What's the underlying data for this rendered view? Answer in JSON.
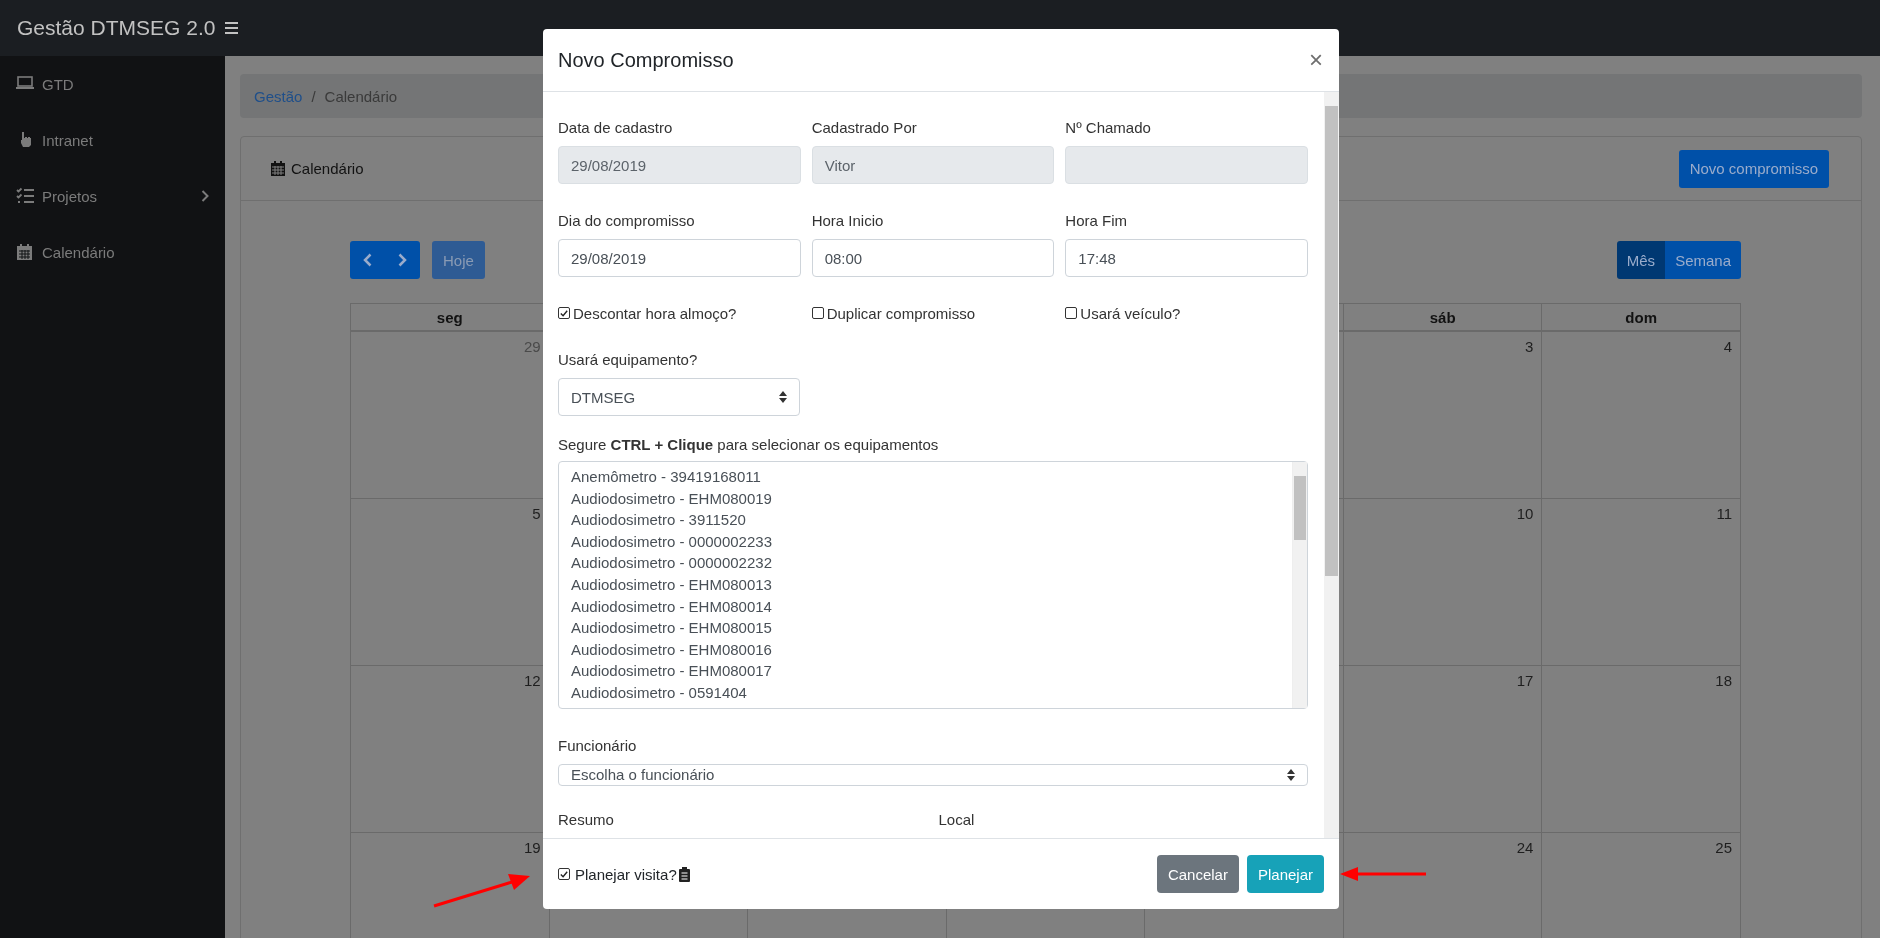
{
  "topbar": {
    "title": "Gestão DTMSEG 2.0"
  },
  "sidebar": {
    "items": [
      {
        "label": "GTD",
        "expandable": false
      },
      {
        "label": "Intranet",
        "expandable": false
      },
      {
        "label": "Projetos",
        "expandable": true
      },
      {
        "label": "Calendário",
        "expandable": false
      }
    ]
  },
  "breadcrumb": [
    {
      "label": "Gestão",
      "link": true
    },
    {
      "label": "/",
      "link": false
    },
    {
      "label": "Calendário",
      "link": false
    }
  ],
  "card": {
    "title": "Calendário",
    "new_button": "Novo compromisso"
  },
  "calendar": {
    "today_button": {
      "label": "Hoje",
      "disabled": true
    },
    "views": [
      {
        "label": "Mês",
        "selected": true
      },
      {
        "label": "Semana",
        "selected": false
      }
    ],
    "columns": [
      {
        "label": "seg",
        "days": [
          {
            "day": "29",
            "other_month": true
          },
          {
            "day": "5",
            "other_month": false
          },
          {
            "day": "12",
            "other_month": false
          },
          {
            "day": "19",
            "other_month": false
          }
        ]
      },
      {
        "label": "sáb",
        "days": [
          {
            "day": "3",
            "other_month": false
          },
          {
            "day": "10",
            "other_month": false
          },
          {
            "day": "17",
            "other_month": false
          },
          {
            "day": "24",
            "other_month": false
          }
        ]
      },
      {
        "label": "dom",
        "days": [
          {
            "day": "4",
            "other_month": false
          },
          {
            "day": "11",
            "other_month": false
          },
          {
            "day": "18",
            "other_month": false
          },
          {
            "day": "25",
            "other_month": false
          }
        ]
      }
    ]
  },
  "modal": {
    "title": "Novo Compromisso",
    "close": "×",
    "fields": [
      {
        "label": "Data de cadastro",
        "value": "29/08/2019",
        "readonly": true
      },
      {
        "label": "Cadastrado Por",
        "value": "Vitor",
        "readonly": true
      },
      {
        "label": "Nº Chamado",
        "readonly": true
      },
      {
        "label": "Dia do compromisso",
        "value": "29/08/2019",
        "readonly": false
      },
      {
        "label": "Hora Inicio",
        "value": "08:00",
        "readonly": false
      },
      {
        "label": "Hora Fim",
        "value": "17:48",
        "readonly": false
      }
    ],
    "checks": [
      {
        "label": "Descontar hora almoço?",
        "checked": true
      },
      {
        "label": "Duplicar compromisso",
        "checked": false
      },
      {
        "label": "Usará veículo?",
        "checked": false
      }
    ],
    "equipment_select": {
      "label": "Usará equipamento?",
      "value": "DTMSEG"
    },
    "hint": "Segure **CTRL + Clique** para selecionar os equipamentos",
    "equipment_list": [
      "Anemômetro - 39419168011",
      "Audiodosimetro - EHM080019",
      "Audiodosimetro - 3911520",
      "Audiodosimetro - 0000002233",
      "Audiodosimetro - 0000002232",
      "Audiodosimetro - EHM080013",
      "Audiodosimetro - EHM080014",
      "Audiodosimetro - EHM080015",
      "Audiodosimetro - EHM080016",
      "Audiodosimetro - EHM080017",
      "Audiodosimetro - 0591404"
    ],
    "employee_select": {
      "label": "Funcionário",
      "value": "Escolha o funcionário"
    },
    "more_labels": [
      "Resumo",
      "Local"
    ],
    "footer": {
      "plan_check": {
        "label": "Planejar visita?",
        "checked": true
      },
      "cancel_button": "Cancelar",
      "plan_button": "Planejar"
    }
  }
}
